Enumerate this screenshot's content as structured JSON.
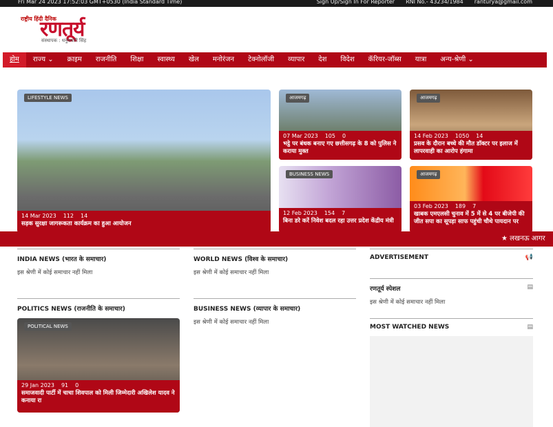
{
  "topbar": {
    "datetime": "Fri Mar 24 2023 17:52:03 GMT+0530 (India Standard Time)",
    "signup": "Sign Up/Sign In For Reporter",
    "rni": "RNI No.- 43234/1984",
    "email": "ranturya@gmail.com"
  },
  "logo": {
    "tagline": "राष्ट्रीय हिंदी दैनिक",
    "name": "रणतूर्य",
    "editor": "संस्थापक : धनुषधारी सिंह"
  },
  "nav": [
    "होम",
    "राज्य ⌄",
    "क्राइम",
    "राजनीति",
    "शिक्षा",
    "स्वास्थ्य",
    "खेल",
    "मनोरंजन",
    "टेक्नोलॉजी",
    "व्यापार",
    "देश",
    "विदेश",
    "कॅरियर-जॉब्स",
    "यात्रा",
    "अन्य-श्रेणी ⌄"
  ],
  "cards": [
    {
      "cat": "LIFESTYLE NEWS",
      "date": "14 Mar 2023",
      "views": "112",
      "shares": "14",
      "title": "सड़क सुरक्षा जागरूकता कार्यक्रम का हुआ आयोजन"
    },
    {
      "cat": "आजमगढ़",
      "date": "07 Mar 2023",
      "views": "105",
      "shares": "0",
      "title": "भट्ठे पर बंधक बनाए गए छत्तीसगढ़ के 8 को पुलिस ने कराया मुक्त"
    },
    {
      "cat": "आजमगढ़",
      "date": "14 Feb 2023",
      "views": "1050",
      "shares": "14",
      "title": "प्रसव के दौरान बच्चे की मौत डॉक्टर पर इलाज में लापरवाही का आरोप हंगामा"
    },
    {
      "cat": "BUSINESS NEWS",
      "date": "12 Feb 2023",
      "views": "154",
      "shares": "7",
      "title": "बिना डरे करें निवेश बदल रहा उत्तर प्रदेश केंद्रीय मंत्री"
    },
    {
      "cat": "आजमगढ़",
      "date": "03 Feb 2023",
      "views": "189",
      "shares": "7",
      "title": "खाबक एमएलसी चुनाव में 5 में से 4 पर बीजेपी की जीत सपा का सूपड़ा साफ पहुंची चौथे पायदान पर"
    },
    {
      "cat": "POLITICAL NEWS",
      "date": "29 Jan 2023",
      "views": "91",
      "shares": "0",
      "title": "समाजवादी पार्टी में चाचा शिवपाल को मिली जिम्मेदारी अखिलेश यादव ने कनाया रा"
    }
  ],
  "ticker": "★ लखनऊ आगर",
  "sections": {
    "india": "INDIA NEWS (भारत के समाचार)",
    "world": "WORLD NEWS (विश्व के समाचार)",
    "politics": "POLITICS NEWS (राजनीति के समाचार)",
    "business": "BUSINESS NEWS (व्यापार के समाचार)",
    "empty": "इस श्रेणी में कोई समाचार नहीं मिला"
  },
  "sidebar": {
    "ad": "ADVERTISEMENT",
    "special": "रणतूर्य स्पेशल",
    "most": "MOST WATCHED NEWS"
  }
}
